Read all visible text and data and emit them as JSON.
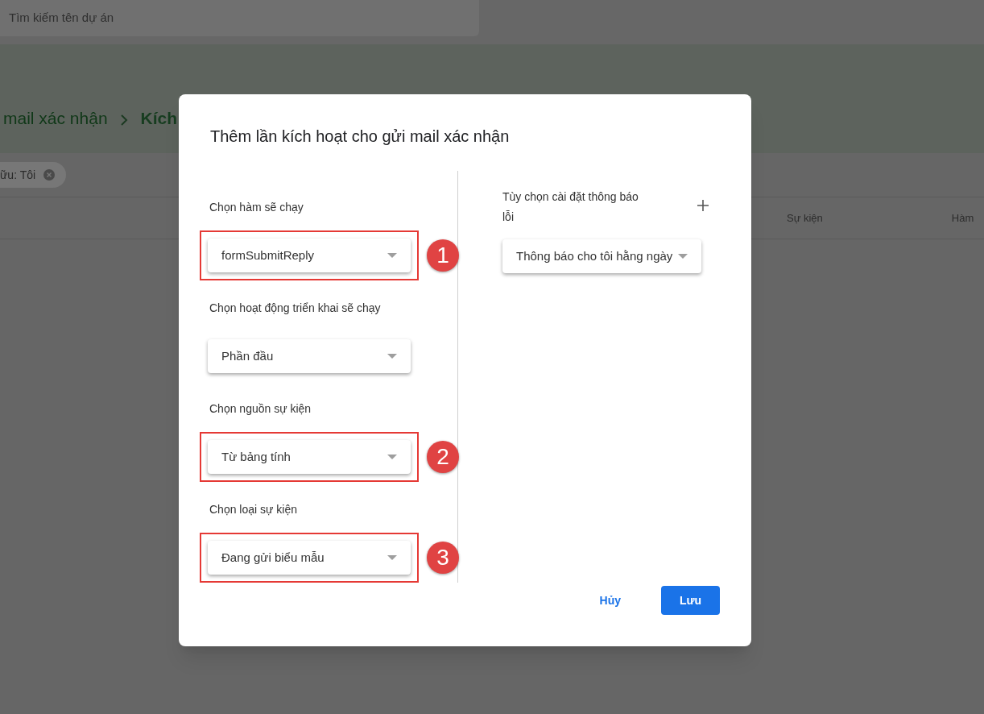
{
  "search": {
    "placeholder": "Tìm kiếm tên dự án"
  },
  "breadcrumb": [
    {
      "label": "mail xác nhận",
      "current": false
    },
    {
      "label": "Kích",
      "current": true
    }
  ],
  "filter_chip": {
    "label": "ữu: Tôi"
  },
  "table": {
    "columns": [
      "Sự kiện",
      "Hàm"
    ]
  },
  "dialog": {
    "title": "Thêm lần kích hoạt cho gửi mail xác nhận",
    "fields": [
      {
        "label": "Chọn hàm sẽ chạy",
        "value": "formSubmitReply",
        "highlighted": true,
        "marker": "1"
      },
      {
        "label": "Chọn hoạt động triển khai sẽ chạy",
        "value": "Phần đầu",
        "highlighted": false
      },
      {
        "label": "Chọn nguồn sự kiện",
        "value": "Từ bảng tính",
        "highlighted": true,
        "marker": "2"
      },
      {
        "label": "Chọn loại sự kiện",
        "value": "Đang gửi biểu mẫu",
        "highlighted": true,
        "marker": "3"
      }
    ],
    "notifications": {
      "label": "Tùy chọn cài đặt thông báo lỗi",
      "value": "Thông báo cho tôi hằng ngày"
    },
    "buttons": [
      {
        "label": "Hủy",
        "kind": "text"
      },
      {
        "label": "Lưu",
        "kind": "primary"
      }
    ]
  }
}
